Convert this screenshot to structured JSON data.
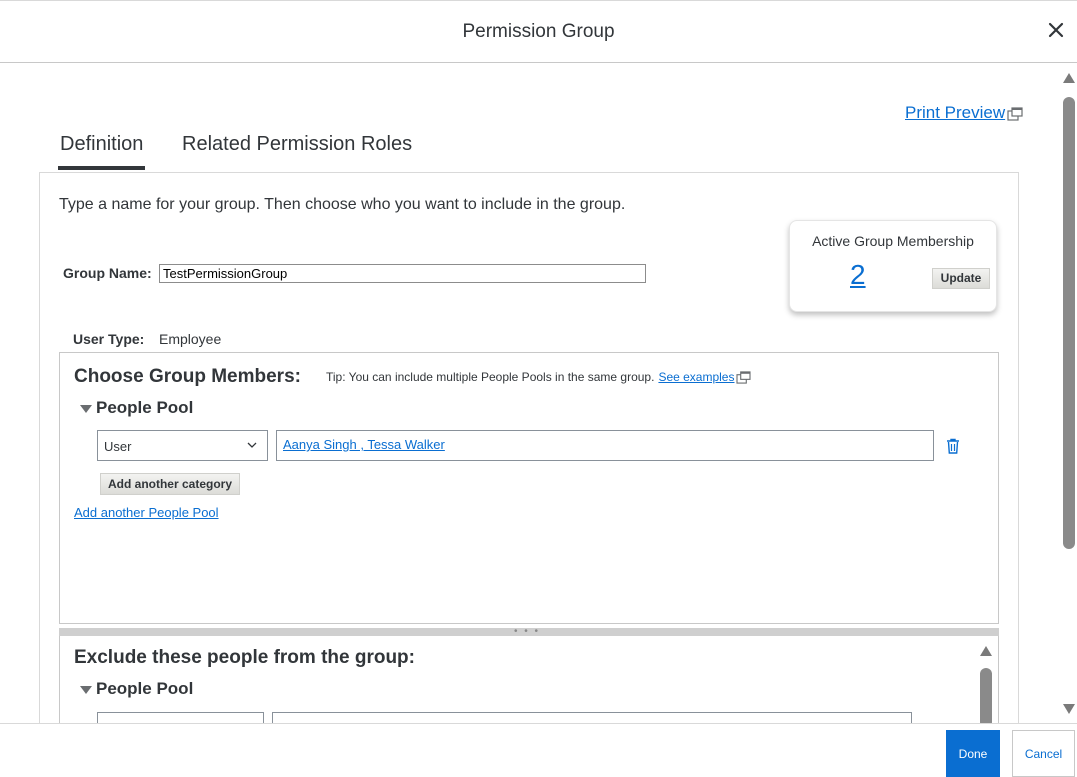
{
  "dialog": {
    "title": "Permission Group",
    "close_icon": "close-icon"
  },
  "print_preview": "Print Preview",
  "tabs": [
    {
      "label": "Definition",
      "active": true
    },
    {
      "label": "Related Permission Roles",
      "active": false
    }
  ],
  "definition": {
    "intro": "Type a name for your group. Then choose who you want to include in the group.",
    "group_name_label": "Group Name:",
    "group_name_value": "TestPermissionGroup",
    "user_type_label": "User Type:",
    "user_type_value": "Employee"
  },
  "active_membership": {
    "label": "Active Group Membership",
    "count": "2",
    "update_label": "Update"
  },
  "choose_members": {
    "title": "Choose Group Members:",
    "tip": "Tip: You can include multiple People Pools in the same group.",
    "see_examples": "See examples",
    "pool_title": "People Pool",
    "category_select": "User",
    "category_value": "Aanya Singh , Tessa Walker",
    "add_category_label": "Add another category",
    "add_pool_label": "Add another People Pool"
  },
  "exclude": {
    "title": "Exclude these people from the group:",
    "pool_title": "People Pool"
  },
  "footer": {
    "done_label": "Done",
    "cancel_label": "Cancel"
  },
  "colors": {
    "accent": "#0a6ed1",
    "text": "#32363a"
  }
}
